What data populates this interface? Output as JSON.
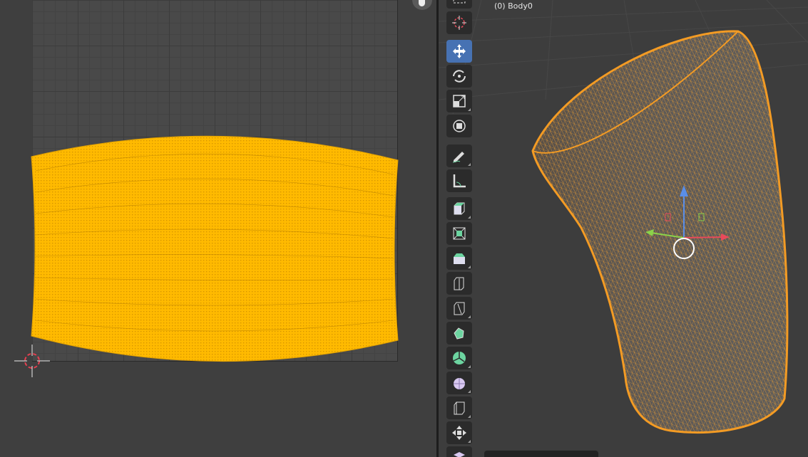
{
  "uv_editor": {
    "mesh_color": "#ffb800",
    "background_color": "#3f3f3f",
    "grid_color": "#494949",
    "cursor_icon": "uv-2d-cursor-icon",
    "overlay_icon": "hand-grab-icon"
  },
  "viewport": {
    "object_label": "(0) Body0",
    "mesh_color": "#f5a030",
    "toolbar": [
      {
        "name": "select-box-tool",
        "icon": "select-box-icon",
        "active": false
      },
      {
        "name": "cursor-tool",
        "icon": "cursor-icon",
        "active": false
      },
      {
        "name": "move-tool",
        "icon": "move-icon",
        "active": true
      },
      {
        "name": "rotate-tool",
        "icon": "rotate-icon",
        "active": false
      },
      {
        "name": "scale-tool",
        "icon": "scale-icon",
        "active": false
      },
      {
        "name": "transform-tool",
        "icon": "transform-icon",
        "active": false
      },
      {
        "name": "annotate-tool",
        "icon": "annotate-icon",
        "active": false
      },
      {
        "name": "measure-tool",
        "icon": "measure-icon",
        "active": false
      },
      {
        "name": "add-cube-tool",
        "icon": "add-cube-icon",
        "active": false
      },
      {
        "name": "extrude-region-tool",
        "icon": "extrude-icon",
        "active": false
      },
      {
        "name": "inset-faces-tool",
        "icon": "inset-icon",
        "active": false
      },
      {
        "name": "bevel-tool",
        "icon": "bevel-icon",
        "active": false
      },
      {
        "name": "loop-cut-tool",
        "icon": "loop-cut-icon",
        "active": false
      },
      {
        "name": "poly-build-tool",
        "icon": "poly-build-icon",
        "active": false
      },
      {
        "name": "spin-tool",
        "icon": "spin-icon",
        "active": false
      },
      {
        "name": "smooth-tool",
        "icon": "smooth-icon",
        "active": false
      },
      {
        "name": "edge-slide-tool",
        "icon": "edge-slide-icon",
        "active": false
      },
      {
        "name": "shrink-fatten-tool",
        "icon": "shrink-fatten-icon",
        "active": false
      },
      {
        "name": "shear-tool",
        "icon": "shear-icon",
        "active": false
      }
    ],
    "gizmo": {
      "x_color": "#e84a5a",
      "y_color": "#8bd24a",
      "z_color": "#5a8ee8"
    }
  }
}
